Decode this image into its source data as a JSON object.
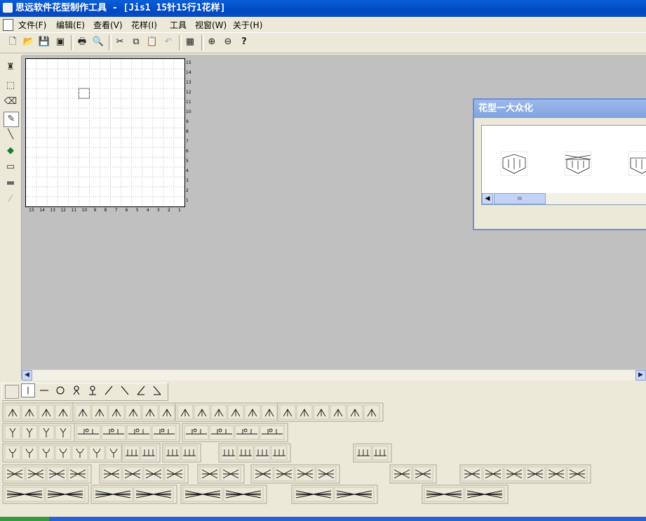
{
  "window": {
    "title": "思远软件花型制作工具 - [Jis1 15针15行1花样]"
  },
  "menu": [
    {
      "label": "文件(F)"
    },
    {
      "label": "编辑(E)"
    },
    {
      "label": "查看(V)"
    },
    {
      "label": "花样(I)"
    },
    {
      "label": "工具"
    },
    {
      "label": "视窗(W)"
    },
    {
      "label": "关于(H)"
    }
  ],
  "toolbar": [
    {
      "icon": "new-file-icon",
      "glyph": "🗋"
    },
    {
      "icon": "open-folder-icon",
      "glyph": "📂"
    },
    {
      "icon": "save-icon",
      "glyph": "💾"
    },
    {
      "icon": "save-all-icon",
      "glyph": "▣"
    },
    {
      "icon": "print-icon",
      "glyph": "🖶"
    },
    {
      "icon": "print-preview-icon",
      "glyph": "🔍"
    },
    {
      "icon": "cut-icon",
      "glyph": "✂"
    },
    {
      "icon": "copy-icon",
      "glyph": "⧉"
    },
    {
      "icon": "paste-icon",
      "glyph": "📋"
    },
    {
      "icon": "undo-icon",
      "glyph": "↶"
    },
    {
      "icon": "grid-icon",
      "glyph": "▦"
    },
    {
      "icon": "zoom-in-icon",
      "glyph": "⊕"
    },
    {
      "icon": "zoom-out-icon",
      "glyph": "⊖"
    },
    {
      "icon": "context-help-icon",
      "glyph": "?"
    }
  ],
  "left_tools": [
    {
      "icon": "stamp-icon",
      "glyph": "♜"
    },
    {
      "icon": "select-rect-icon",
      "glyph": "⬚"
    },
    {
      "icon": "eraser-icon",
      "glyph": "⌫"
    },
    {
      "icon": "pencil-icon",
      "glyph": "✎"
    },
    {
      "icon": "line-icon",
      "glyph": "╲"
    },
    {
      "icon": "fill-bucket-icon",
      "glyph": "◆"
    },
    {
      "icon": "rectangle-icon",
      "glyph": "▭"
    },
    {
      "icon": "filled-rectangle-icon",
      "glyph": "▬"
    },
    {
      "icon": "dropper-icon",
      "glyph": "⁄"
    }
  ],
  "canvas": {
    "rows": 15,
    "cols": 15,
    "row_labels": [
      "15",
      "14",
      "13",
      "12",
      "11",
      "10",
      "9",
      "8",
      "7",
      "6",
      "5",
      "4",
      "3",
      "2",
      "1"
    ],
    "col_labels": [
      "15",
      "14",
      "13",
      "12",
      "11",
      "10",
      "9",
      "8",
      "7",
      "6",
      "5",
      "4",
      "3",
      "2",
      "1"
    ]
  },
  "pattern_window": {
    "title": "花型一大众化",
    "scroll_thumb": "III"
  },
  "colors": {
    "title_blue": "#0A5FD8",
    "workspace_gray": "#C0C0C0",
    "panel": "#ECE9D8"
  }
}
